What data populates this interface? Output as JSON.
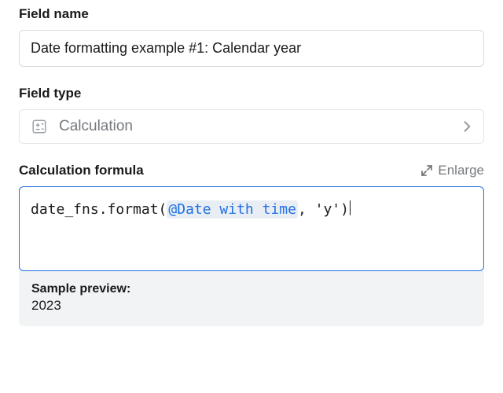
{
  "field_name": {
    "label": "Field name",
    "value": "Date formatting example #1: Calendar year"
  },
  "field_type": {
    "label": "Field type",
    "icon_name": "calculation-icon",
    "value": "Calculation"
  },
  "formula": {
    "label": "Calculation formula",
    "enlarge_label": "Enlarge",
    "prefix": "date_fns.format(",
    "reference": "@Date with time",
    "suffix": ", 'y')"
  },
  "preview": {
    "label": "Sample preview:",
    "value": "2023"
  }
}
